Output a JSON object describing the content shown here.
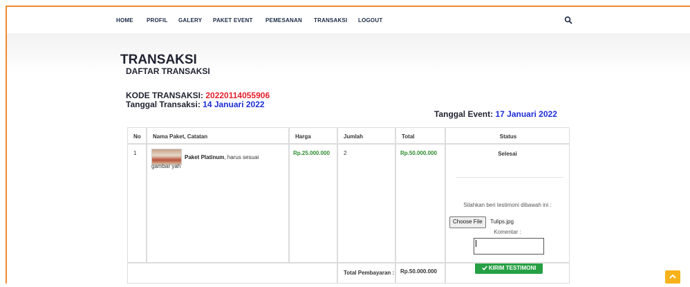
{
  "nav": {
    "items": [
      "HOME",
      "PROFIL",
      "GALERY",
      "PAKET EVENT",
      "PEMESANAN",
      "TRANSAKSI",
      "LOGOUT"
    ]
  },
  "page": {
    "title": "TRANSAKSI",
    "subtitle": "DAFTAR TRANSAKSI",
    "kode_label": "KODE TRANSAKSI:",
    "kode_value": "20220114055906",
    "tgl_label": "Tanggal Transaksi:",
    "tgl_value": "14 Januari 2022",
    "event_label": "Tanggal Event:",
    "event_value": "17 Januari 2022"
  },
  "table": {
    "headers": [
      "No",
      "Nama Paket, Catatan",
      "Harga",
      "Jumlah",
      "Total",
      "Status"
    ],
    "row": {
      "no": "1",
      "paket": "Paket Platinum",
      "catatan": ", harus sesuai gambar yah",
      "harga": "Rp.25.000.000",
      "jumlah": "2",
      "total": "Rp.50.000.000",
      "status": "Selesai"
    },
    "testimoni": {
      "prompt": "Silahkan beri testimoni dibawah ini :",
      "choose_label": "Choose File",
      "file_name": "Tulips.jpg",
      "komentar_label": "Komentar :",
      "submit_label": "KIRIM TESTIMONI"
    },
    "footer": {
      "label": "Total Pembayaran :",
      "value": "Rp.50.000.000"
    }
  },
  "colors": {
    "accent": "#f0892e",
    "red": "#e3202b",
    "blue": "#1e2dd6",
    "green": "#2e8b2e",
    "button_green": "#27a045",
    "scroll_top": "#f6b21a"
  },
  "icons": {
    "search": "search-icon",
    "check": "check-icon",
    "chevron_up": "chevron-up-icon"
  }
}
